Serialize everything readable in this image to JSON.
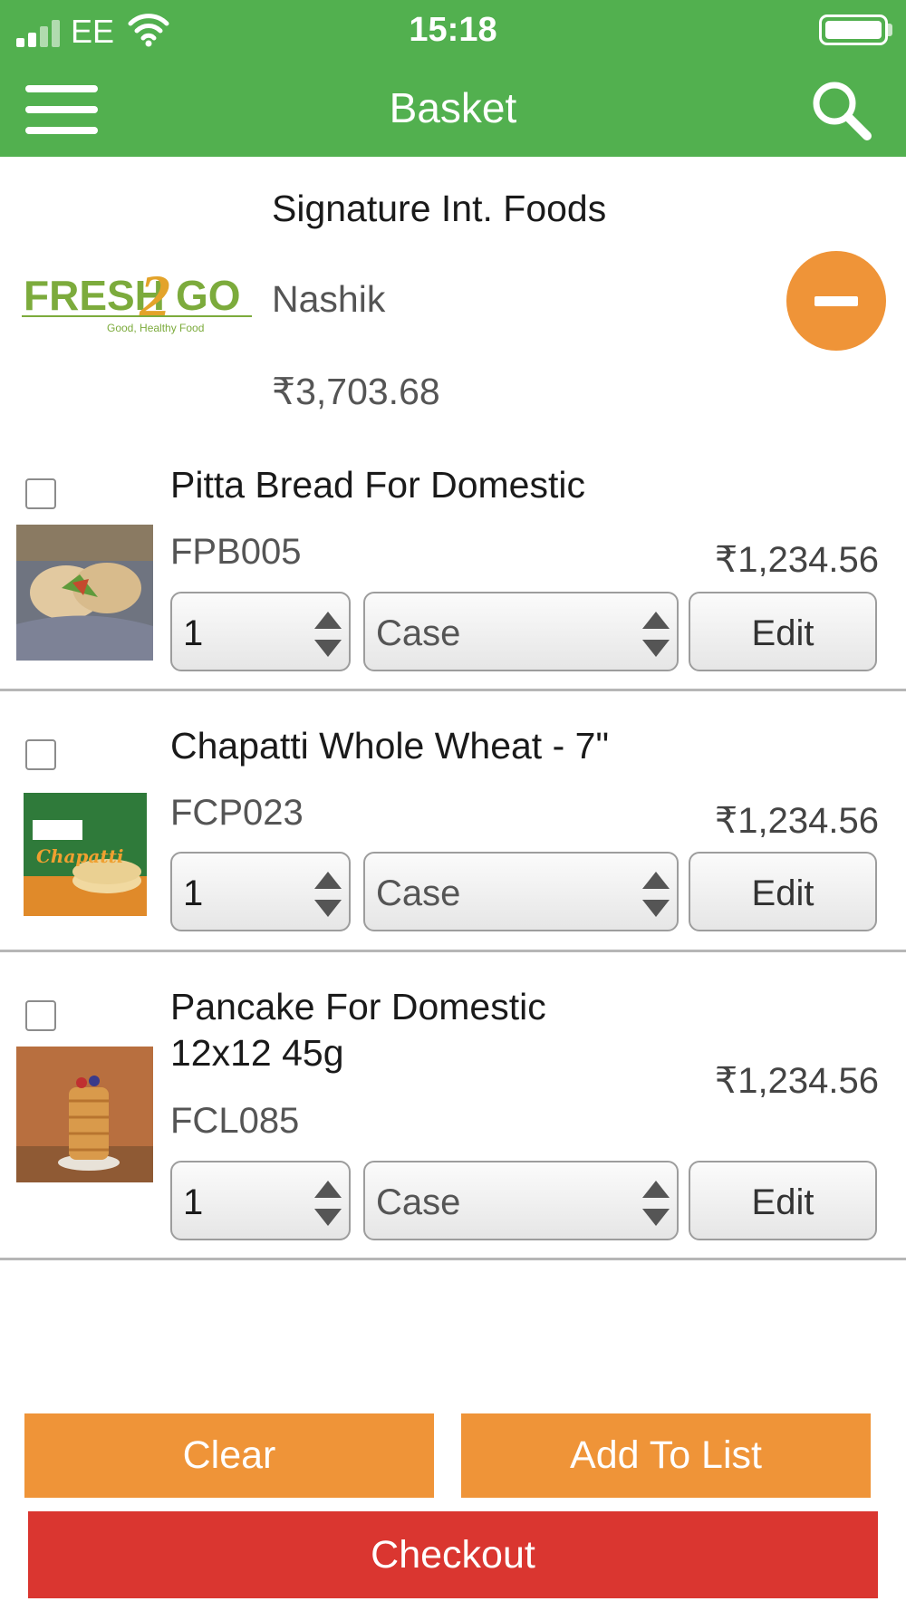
{
  "status_bar": {
    "carrier": "EE",
    "time": "15:18"
  },
  "header": {
    "title": "Basket",
    "menu_icon": "hamburger-menu-icon",
    "search_icon": "search-icon"
  },
  "colors": {
    "header_bg": "#52b04f",
    "accent_orange": "#ef9438",
    "checkout_red": "#da3630"
  },
  "supplier": {
    "name": "Signature Int. Foods",
    "location": "Nashik",
    "total": "₹3,703.68",
    "logo": {
      "brand_left": "FRESH",
      "brand_digit": "2",
      "brand_right": "GO",
      "tagline": "Good, Healthy Food"
    }
  },
  "items": [
    {
      "name": "Pitta Bread For Domestic",
      "code": "FPB005",
      "price": "₹1,234.56",
      "quantity": "1",
      "unit": "Case",
      "edit_label": "Edit",
      "checked": false
    },
    {
      "name": "Chapatti Whole Wheat - 7\"",
      "code": "FCP023",
      "price": "₹1,234.56",
      "quantity": "1",
      "unit": "Case",
      "edit_label": "Edit",
      "checked": false
    },
    {
      "name": "Pancake For Domestic 12x12 45g",
      "code": "FCL085",
      "price": "₹1,234.56",
      "quantity": "1",
      "unit": "Case",
      "edit_label": "Edit",
      "checked": false
    }
  ],
  "footer": {
    "clear_label": "Clear",
    "add_to_list_label": "Add To List",
    "checkout_label": "Checkout"
  }
}
